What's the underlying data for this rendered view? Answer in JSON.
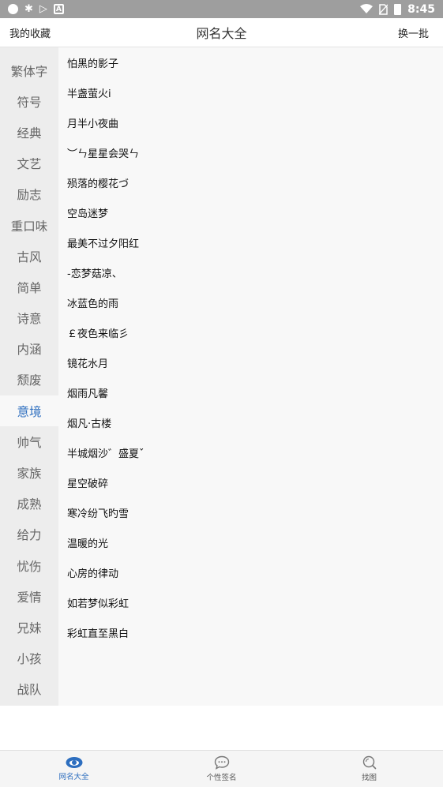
{
  "status": {
    "time": "8:45"
  },
  "header": {
    "favorites": "我的收藏",
    "title": "网名大全",
    "refresh": "换一批"
  },
  "categories": [
    {
      "label": "繁体字"
    },
    {
      "label": "符号"
    },
    {
      "label": "经典"
    },
    {
      "label": "文艺"
    },
    {
      "label": "励志"
    },
    {
      "label": "重口味"
    },
    {
      "label": "古风"
    },
    {
      "label": "简单"
    },
    {
      "label": "诗意"
    },
    {
      "label": "内涵"
    },
    {
      "label": "颓废"
    },
    {
      "label": "意境"
    },
    {
      "label": "帅气"
    },
    {
      "label": "家族"
    },
    {
      "label": "成熟"
    },
    {
      "label": "给力"
    },
    {
      "label": "忧伤"
    },
    {
      "label": "爱情"
    },
    {
      "label": "兄妹"
    },
    {
      "label": "小孩"
    },
    {
      "label": "战队"
    }
  ],
  "active_category": "意境",
  "names": [
    "怕黑的影子",
    "半盏萤火i",
    "月半小夜曲",
    "︶ㄣ星星会哭ㄣ",
    "殒落的樱花づ",
    "空岛迷梦",
    "最美不过夕阳红",
    "-恋梦菇凉、",
    "冰蓝色的雨",
    "￡夜色来临彡",
    "镜花水月",
    "烟雨凡馨",
    "烟凡·古楼",
    "半城烟沙゛盛夏ˇ",
    "星空破碎",
    "寒冷纷飞旳雪",
    "温暖的光",
    "心房的律动",
    "如若梦似彩虹",
    "彩虹直至黑白"
  ],
  "tabs": [
    {
      "label": "网名大全",
      "icon": "eye-icon"
    },
    {
      "label": "个性签名",
      "icon": "chat-icon"
    },
    {
      "label": "找图",
      "icon": "search-icon"
    }
  ],
  "colors": {
    "accent": "#2d6ebf",
    "statusbar": "#9e9e9e",
    "sidebar": "#ededed",
    "content": "#f8f8f8"
  }
}
